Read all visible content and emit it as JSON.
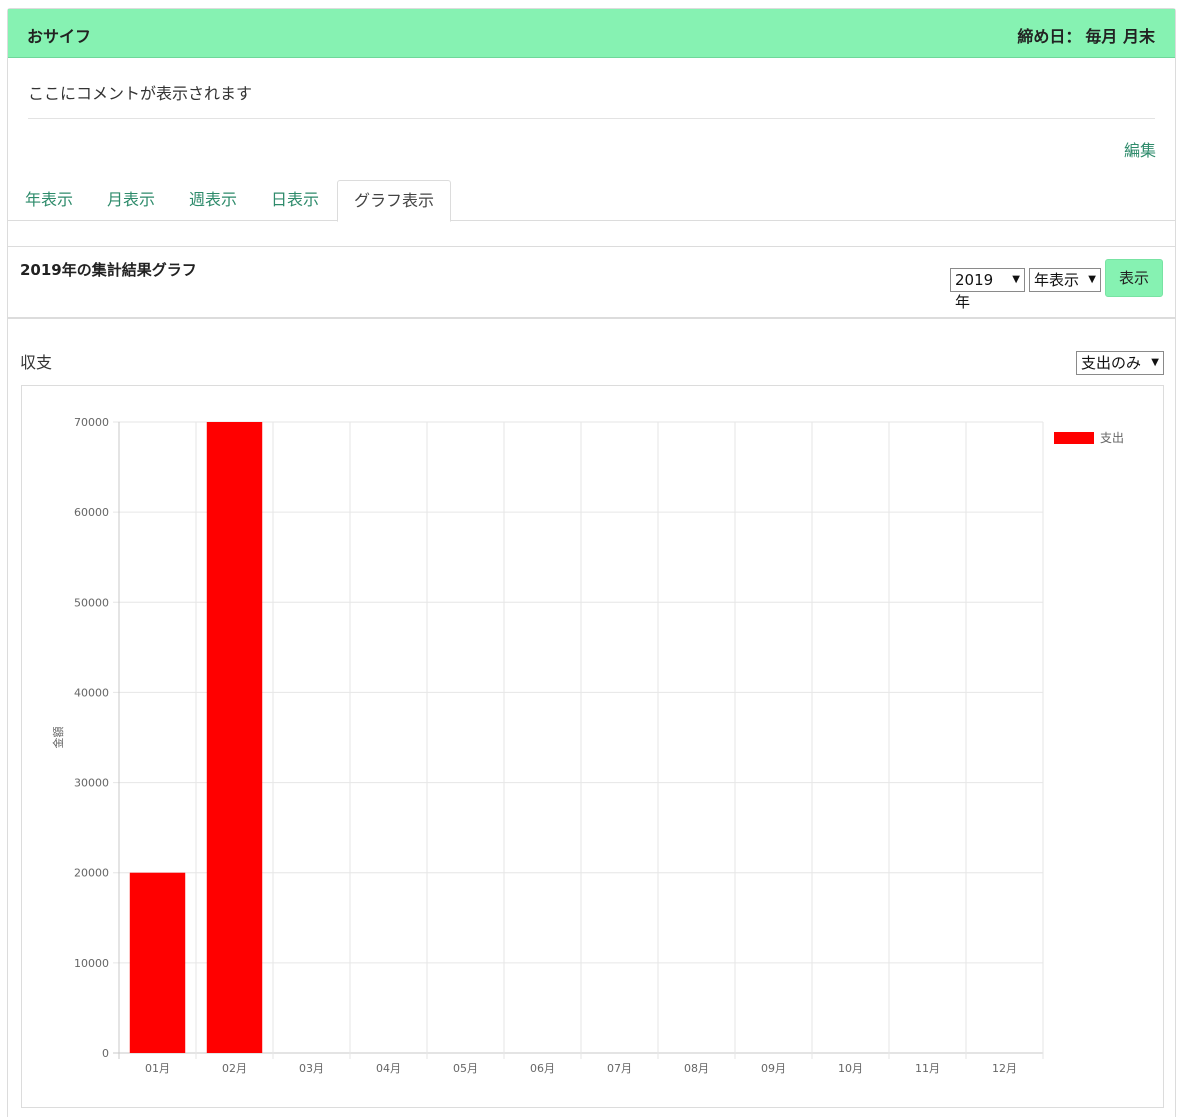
{
  "wallet": {
    "title": "おサイフ",
    "close_day_label": "締め日：",
    "close_day_value": "毎月 月末"
  },
  "comment": "ここにコメントが表示されます",
  "edit_label": "編集",
  "tabs": [
    {
      "label": "年表示",
      "active": false
    },
    {
      "label": "月表示",
      "active": false
    },
    {
      "label": "週表示",
      "active": false
    },
    {
      "label": "日表示",
      "active": false
    },
    {
      "label": "グラフ表示",
      "active": true
    }
  ],
  "graph": {
    "title": "2019年の集計結果グラフ",
    "year_select": "2019年",
    "mode_select": "年表示",
    "show_button": "表示",
    "section_label": "収支",
    "filter_select": "支出のみ"
  },
  "colors": {
    "accent": "#86f2b2",
    "link": "#2e8b6b",
    "bar": "#ff0000"
  },
  "chart_data": {
    "type": "bar",
    "categories": [
      "01月",
      "02月",
      "03月",
      "04月",
      "05月",
      "06月",
      "07月",
      "08月",
      "09月",
      "10月",
      "11月",
      "12月"
    ],
    "series": [
      {
        "name": "支出",
        "values": [
          20000,
          70000,
          0,
          0,
          0,
          0,
          0,
          0,
          0,
          0,
          0,
          0
        ],
        "color": "#ff0000"
      }
    ],
    "ylabel": "金額",
    "ylim": [
      0,
      70000
    ],
    "yticks": [
      0,
      10000,
      20000,
      30000,
      40000,
      50000,
      60000,
      70000
    ],
    "grid": true,
    "legend_position": "top-right"
  }
}
